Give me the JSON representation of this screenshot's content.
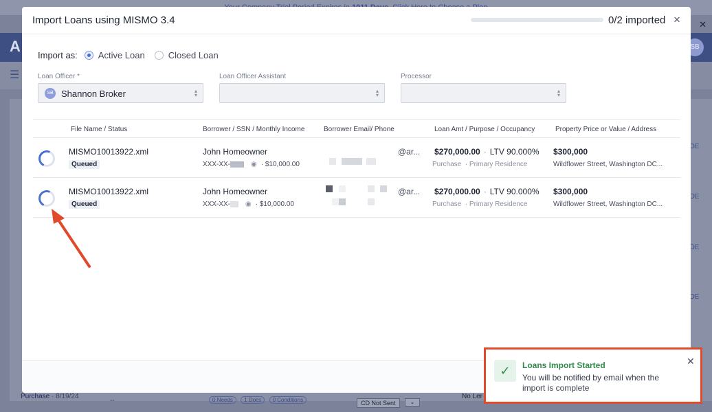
{
  "background": {
    "banner_text": "Your Company Trial Period Expires in ",
    "banner_days": "1011 Days",
    "banner_link": ". Click Here to Choose a Plan",
    "logo_letter": "A",
    "avatar_initials": "SB",
    "bottom_purpose": "Purchase",
    "bottom_date": "· 8/19/24",
    "bottom_dash": "--",
    "pill_needs": "0 Needs",
    "pill_docs": "1 Docs",
    "pill_conditions": "0 Conditions",
    "cd_status": "CD Not Sent",
    "no_lender": "No Ler",
    "side_oe": "OE"
  },
  "modal": {
    "title": "Import Loans using MISMO 3.4",
    "progress_text": "0/2 imported",
    "progress_fraction": 0.0,
    "close_icon": "×"
  },
  "import_as": {
    "label": "Import as:",
    "options": [
      "Active Loan",
      "Closed Loan"
    ],
    "selected": "Active Loan"
  },
  "fields": {
    "loan_officer_label": "Loan Officer *",
    "loan_officer_initials": "SB",
    "loan_officer_value": "Shannon Broker",
    "assistant_label": "Loan Officer Assistant",
    "processor_label": "Processor"
  },
  "table": {
    "headers": [
      "File Name / Status",
      "Borrower / SSN / Monthly Income",
      "Borrower Email/ Phone",
      "Loan Amt / Purpose / Occupancy",
      "Property Price or Value / Address"
    ],
    "rows": [
      {
        "file_name": "MISMO10013922.xml",
        "status": "Queued",
        "borrower": "John Homeowner",
        "ssn_prefix": "XXX-XX-",
        "income": "$10,000.00",
        "email_tail": "@ar...",
        "loan_amount": "$270,000.00",
        "ltv": "LTV 90.000%",
        "purpose": "Purchase",
        "occupancy": "Primary Residence",
        "price": "$300,000",
        "address": "Wildflower Street, Washington DC..."
      },
      {
        "file_name": "MISMO10013922.xml",
        "status": "Queued",
        "borrower": "John Homeowner",
        "ssn_prefix": "XXX-XX-",
        "income": "$10,000.00",
        "email_tail": "@ar...",
        "loan_amount": "$270,000.00",
        "ltv": "LTV 90.000%",
        "purpose": "Purchase",
        "occupancy": "Primary Residence",
        "price": "$300,000",
        "address": "Wildflower Street, Washington DC..."
      }
    ]
  },
  "toast": {
    "title": "Loans Import Started",
    "body": "You will be notified by email when the import is complete",
    "icon": "check-icon",
    "annotation_color": "#e04a2a",
    "success_color": "#2f8a4b"
  }
}
